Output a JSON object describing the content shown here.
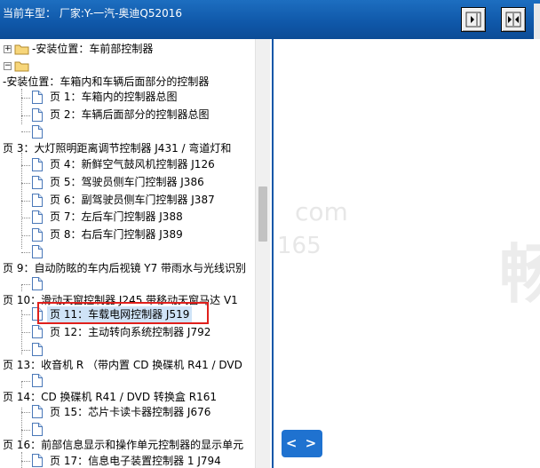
{
  "header": {
    "title": "当前车型： 厂家:Y-一汽-奥迪Q52016"
  },
  "tree": {
    "items": [
      {
        "label": "-安装位置：车前部控制器"
      },
      {
        "label": ""
      },
      {
        "label": "-安装位置：车箱内和车辆后面部分的控制器"
      },
      {
        "label": "页 1：车箱内的控制器总图"
      },
      {
        "label": "页 2：车辆后面部分的控制器总图"
      },
      {
        "label": ""
      },
      {
        "label": "页 3：大灯照明距离调节控制器 J431 / 弯道灯和"
      },
      {
        "label": "页 4：新鲜空气鼓风机控制器 J126"
      },
      {
        "label": "页 5：驾驶员侧车门控制器 J386"
      },
      {
        "label": "页 6：副驾驶员侧车门控制器 J387"
      },
      {
        "label": "页 7：左后车门控制器 J388"
      },
      {
        "label": "页 8：右后车门控制器 J389"
      },
      {
        "label": ""
      },
      {
        "label": "页 9：自动防眩的车内后视镜 Y7 带雨水与光线识别"
      },
      {
        "label": ""
      },
      {
        "label": "页 10：滑动天窗控制器 J245 带移动天窗马达 V1"
      },
      {
        "label": "页 11：车载电网控制器 J519"
      },
      {
        "label": "页 12：主动转向系统控制器 J792"
      },
      {
        "label": ""
      },
      {
        "label": "页 13：收音机 R （带内置 CD 换碟机 R41 / DVD"
      },
      {
        "label": ""
      },
      {
        "label": "页 14：CD 换碟机 R41 / DVD 转换盒 R161"
      },
      {
        "label": "页 15：芯片卡读卡器控制器 J676"
      },
      {
        "label": ""
      },
      {
        "label": "页 16：前部信息显示和操作单元控制器的显示单元"
      },
      {
        "label": "页 17：信息电子装置控制器 1 J794"
      }
    ]
  },
  "content": {
    "watermark_1": "com",
    "watermark_2": "165",
    "watermark_big": "畅",
    "nav_label": "< >"
  },
  "colors": {
    "header": "#0f57a8",
    "selection": "#cfe3f7",
    "highlight_box": "#e0201c",
    "nav_button": "#1f72d0"
  }
}
